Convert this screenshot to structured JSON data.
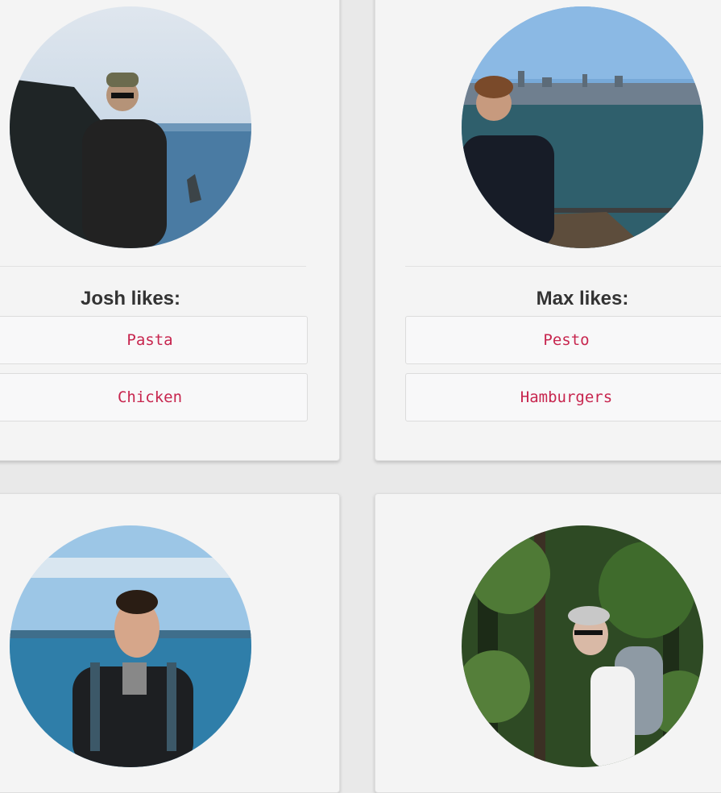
{
  "cards": [
    {
      "name": "Josh",
      "title": "Josh likes:",
      "likes": [
        "Pasta",
        "Chicken"
      ],
      "photo": "man-on-sea-cliff"
    },
    {
      "name": "Max",
      "title": "Max likes:",
      "likes": [
        "Pesto",
        "Hamburgers"
      ],
      "photo": "man-by-bay-with-city-skyline"
    },
    {
      "photo": "man-at-ocean-beach"
    },
    {
      "photo": "hiker-in-forest"
    }
  ],
  "colors": {
    "background": "#e9e9e9",
    "card": "#f4f4f4",
    "like_text": "#c7254e",
    "title_text": "#333333"
  }
}
